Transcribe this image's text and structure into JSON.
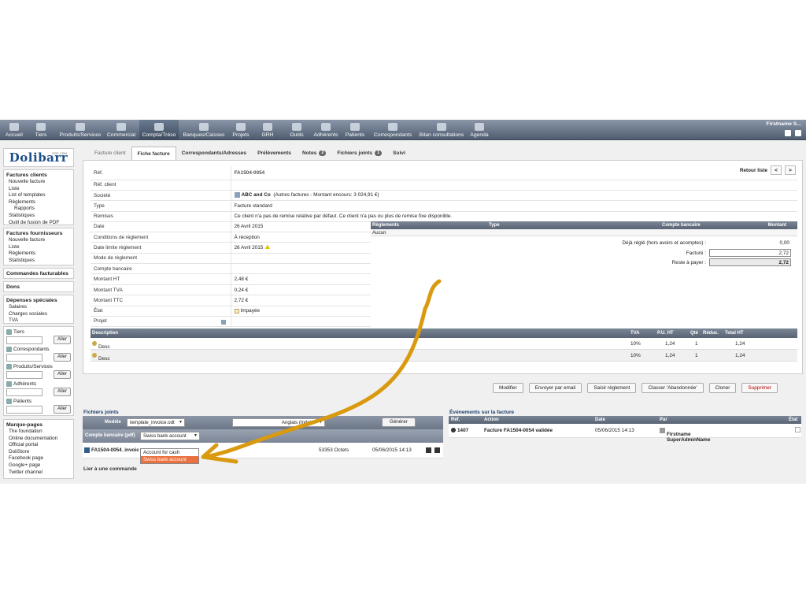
{
  "menu": {
    "items": [
      {
        "label": "Accueil"
      },
      {
        "label": "Tiers"
      },
      {
        "label": "Produits/Services"
      },
      {
        "label": "Commercial"
      },
      {
        "label": "Compta/Tréso"
      },
      {
        "label": "Banques/Caisses"
      },
      {
        "label": "Projets"
      },
      {
        "label": "GRH"
      },
      {
        "label": "Outils"
      },
      {
        "label": "Adhérents"
      },
      {
        "label": "Patients"
      },
      {
        "label": "Correspondants"
      },
      {
        "label": "Bilan consultations"
      },
      {
        "label": "Agenda"
      }
    ],
    "user": "Firstname S..."
  },
  "logo": {
    "text": "Dolibarr",
    "sub": "ERP-CRM"
  },
  "left": {
    "factures_clients": {
      "title": "Factures clients",
      "items": [
        "Nouvelle facture",
        "Liste",
        "List of templates",
        "Règlements"
      ],
      "sub": "Rapports",
      "items2": [
        "Statistiques",
        "Outil de fusion de PDF"
      ]
    },
    "factures_fournisseurs": {
      "title": "Factures fournisseurs",
      "items": [
        "Nouvelle facture",
        "Liste",
        "Règlements",
        "Statistiques"
      ]
    },
    "commandes": "Commandes facturables",
    "dons": "Dons",
    "depenses": {
      "title": "Dépenses spéciales",
      "items": [
        "Salaires",
        "Charges sociales",
        "TVA"
      ]
    },
    "search": {
      "labels": [
        "Tiers",
        "Correspondants",
        "Produits/Services",
        "Adhérents",
        "Patients"
      ],
      "button": "Aller"
    },
    "bookmarks": {
      "title": "Marque-pages",
      "items": [
        "The foundation",
        "Online documentation",
        "Official portal",
        "DoliStore",
        "Facebook page",
        "Google+ page",
        "Twitter channel"
      ]
    }
  },
  "tabs": [
    {
      "label": "Facture client"
    },
    {
      "label": "Fiche facture"
    },
    {
      "label": "Correspondants/Adresses"
    },
    {
      "label": "Prélèvements"
    },
    {
      "label": "Notes",
      "badge": "2"
    },
    {
      "label": "Fichiers joints",
      "badge": "1"
    },
    {
      "label": "Suivi"
    }
  ],
  "card": {
    "nav": {
      "label": "Retour liste",
      "prev": "<",
      "next": ">"
    },
    "rows_top": [
      {
        "k": "Réf.",
        "v": "FA1504-0054"
      },
      {
        "k": "Réf. client",
        "v": ""
      },
      {
        "k": "Société",
        "v": "ABC and Co",
        "extra": "(Autres factures - Montant encours: 3 024,91 €)"
      },
      {
        "k": "Type",
        "v": "Facture standard"
      },
      {
        "k": "Remises",
        "v": "Ce client n'a pas de remise relative par défaut. Ce client n'a pas ou plus de remise fixe disponible."
      }
    ],
    "rows_left": [
      {
        "k": "Date",
        "v": "26 Avril 2015"
      },
      {
        "k": "Conditions de règlement",
        "v": "À réception"
      },
      {
        "k": "Date limite règlement",
        "v": "26 Avril 2015"
      },
      {
        "k": "Mode de règlement",
        "v": ""
      },
      {
        "k": "Compte bancaire",
        "v": ""
      },
      {
        "k": "Montant HT",
        "v": "2,48 €"
      },
      {
        "k": "Montant TVA",
        "v": "0,24 €"
      },
      {
        "k": "Montant TTC",
        "v": "2,72 €"
      },
      {
        "k": "État",
        "v": "Impayée"
      },
      {
        "k": "Projet",
        "v": ""
      }
    ],
    "payments": {
      "headers": [
        "Règlements",
        "Type",
        "Compte bancaire",
        "Montant"
      ],
      "none": "Aucun",
      "already_paid_label": "Déjà réglé (hors avoirs et acomptes) :",
      "already_paid": "0,00",
      "billed_label": "Facturé :",
      "billed": "2,72",
      "remain_label": "Reste à payer :",
      "remain": "2,72"
    },
    "lines": {
      "headers": [
        "Description",
        "TVA",
        "P.U. HT",
        "Qté",
        "Réduc.",
        "Total HT"
      ],
      "rows": [
        {
          "desc": "Desc",
          "tva": "10%",
          "pu": "1,24",
          "qty": "1",
          "total": "1,24"
        },
        {
          "desc": "Desc",
          "tva": "10%",
          "pu": "1,24",
          "qty": "1",
          "total": "1,24"
        }
      ]
    }
  },
  "actions": [
    "Modifier",
    "Envoyer par email",
    "Saisir règlement",
    "Classer 'Abandonnée'",
    "Cloner",
    "Supprimer"
  ],
  "files": {
    "title": "Fichiers joints",
    "model_label": "Modèle",
    "model_value": "template_invoice.odt",
    "lang_value": "Anglais (Inde)",
    "generate": "Générer",
    "bank_label": "Compte bancaire (pdf)",
    "bank_value": "Swiss bank account",
    "file_name": "FA1504-0054_invoic",
    "file_size": "53353 Octets",
    "file_date": "05/06/2015 14:13",
    "dropdown": [
      "Account for cash",
      "Swiss bank account"
    ],
    "link_order": "Lier à une commande"
  },
  "events": {
    "title": "Événements sur la facture",
    "headers": [
      "Réf.",
      "Action",
      "Date",
      "Par",
      "État"
    ],
    "row": {
      "ref": "1407",
      "action": "Facture FA1504-0054 validée",
      "date": "05/06/2015 14:13",
      "by": "Firstname SuperAdminName"
    }
  },
  "annotation": {
    "color": "#d99a10"
  }
}
